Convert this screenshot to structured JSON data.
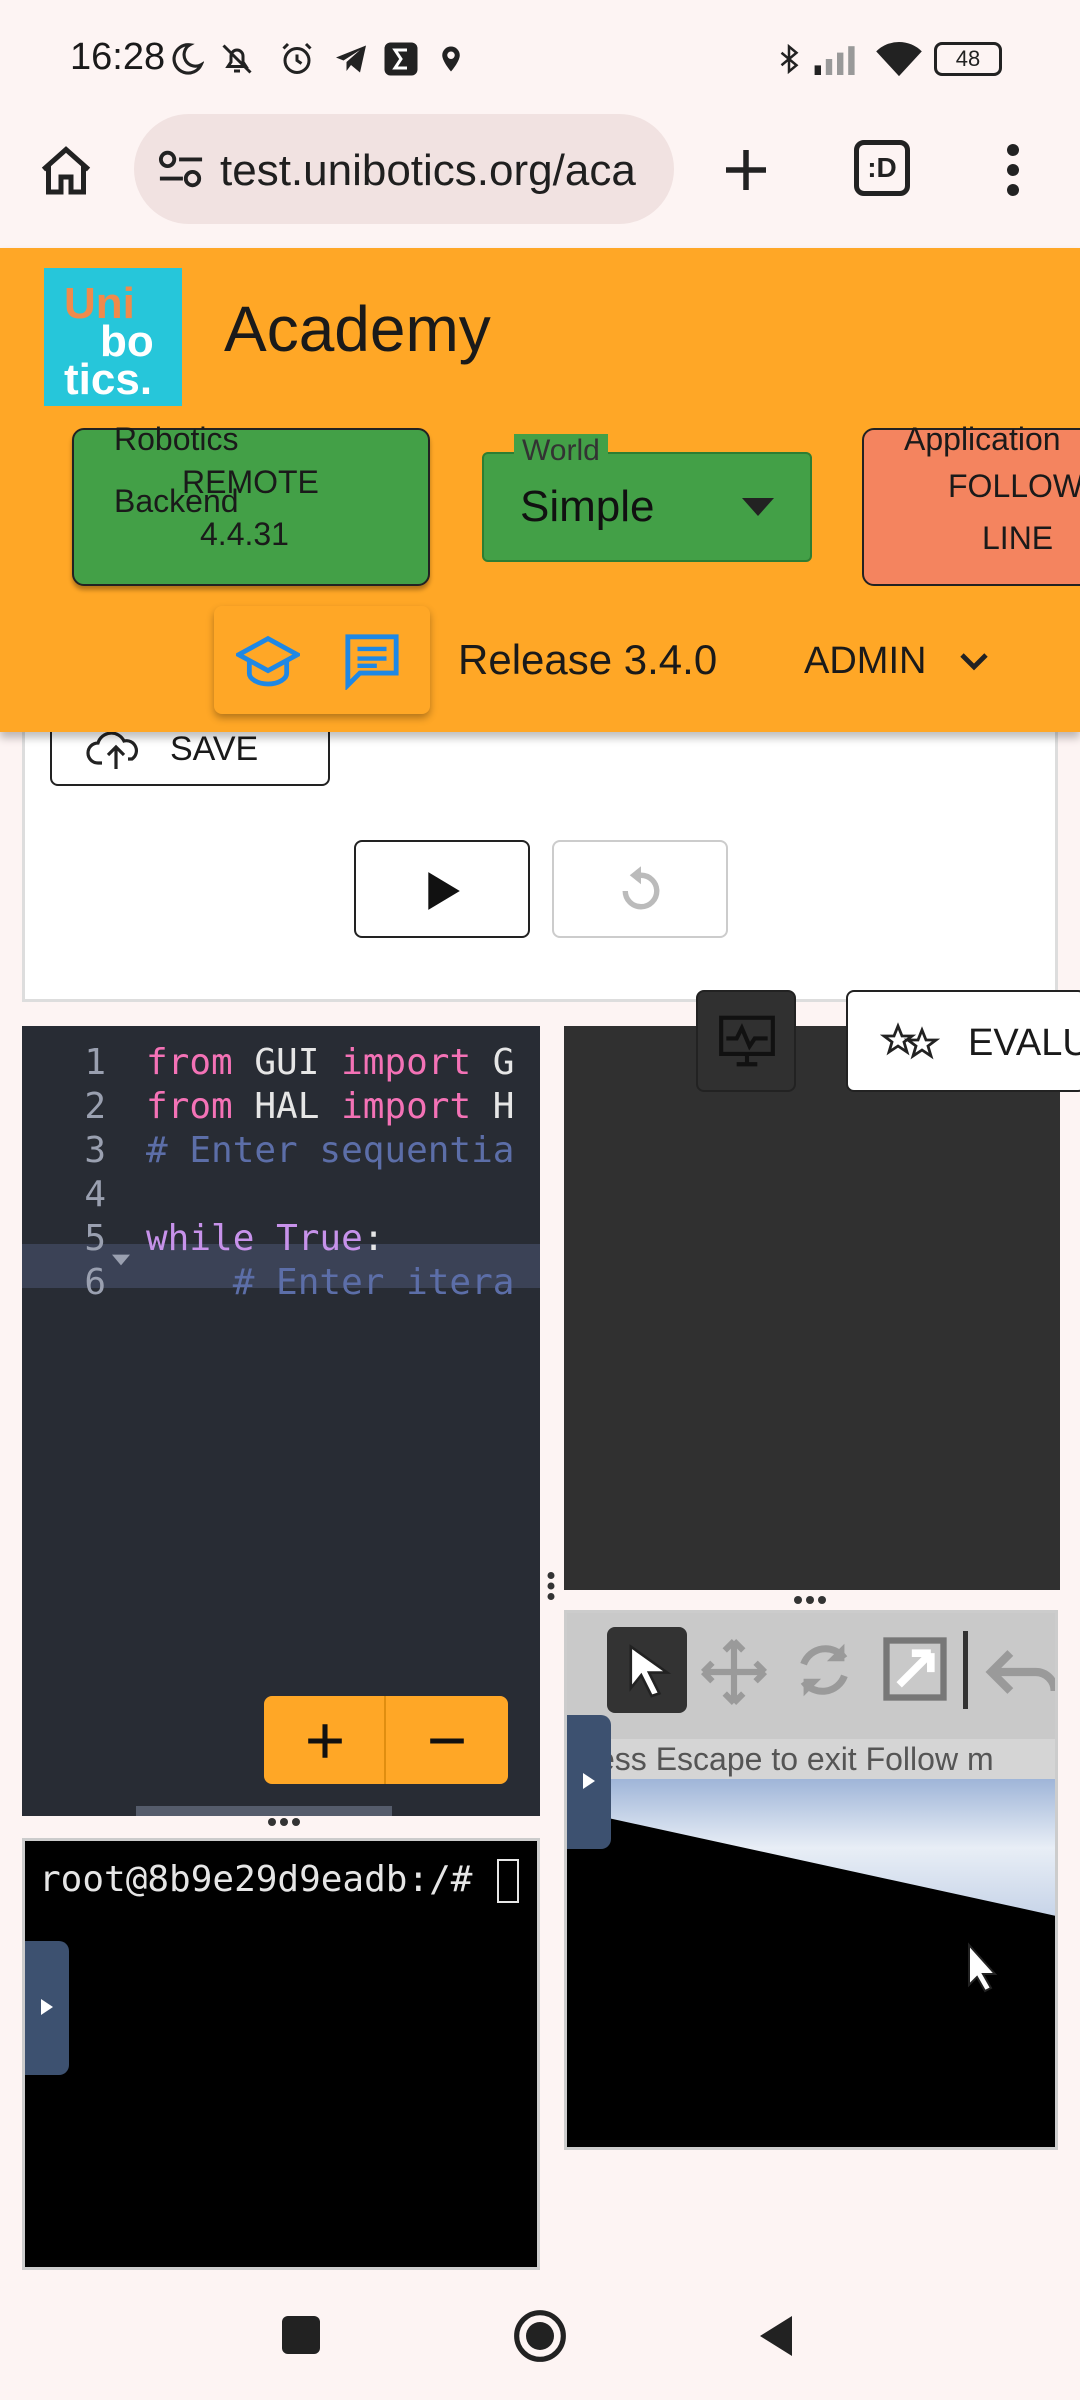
{
  "status_bar": {
    "time": "16:28",
    "battery": "48",
    "icons": [
      "moon-icon",
      "mute-icon",
      "alarm-icon",
      "telegram-icon",
      "sigma-icon",
      "location-icon",
      "bluetooth-icon",
      "signal-icon",
      "wifi-icon",
      "battery-icon"
    ]
  },
  "browser": {
    "url": "test.unibotics.org/aca",
    "tab_label": ":D"
  },
  "header": {
    "logo_lines": [
      "Uni",
      "bo",
      "tics."
    ],
    "title": "Academy",
    "robotics_backend": {
      "label": "Robotics Backend",
      "value_line1": "REMOTE",
      "value_line2": "4.4.31"
    },
    "world": {
      "label": "World",
      "value": "Simple"
    },
    "application": {
      "label": "Application",
      "value_line1": "FOLLOW",
      "value_line2": "LINE"
    },
    "release": "Release 3.4.0",
    "user": "ADMIN"
  },
  "toolbar": {
    "save_label": "SAVE",
    "evaluate_label": "EVALU"
  },
  "editor": {
    "lines": [
      {
        "n": "1",
        "parts": [
          [
            "kw",
            "from"
          ],
          [
            "txt",
            " GUI "
          ],
          [
            "kw",
            "import"
          ],
          [
            "txt",
            " G"
          ]
        ]
      },
      {
        "n": "2",
        "parts": [
          [
            "kw",
            "from"
          ],
          [
            "txt",
            " HAL "
          ],
          [
            "kw",
            "import"
          ],
          [
            "txt",
            " H"
          ]
        ]
      },
      {
        "n": "3",
        "parts": [
          [
            "cm",
            "# Enter sequentia"
          ]
        ]
      },
      {
        "n": "4",
        "parts": []
      },
      {
        "n": "5",
        "parts": [
          [
            "kw2",
            "while"
          ],
          [
            "txt",
            " "
          ],
          [
            "kw2",
            "True"
          ],
          [
            "txt",
            ":"
          ]
        ]
      },
      {
        "n": "6",
        "parts": [
          [
            "cm",
            "    # Enter itera"
          ]
        ]
      }
    ]
  },
  "terminal": {
    "prompt": "root@8b9e29d9eadb:/# "
  },
  "viewer": {
    "hint": "ess Escape to exit Follow m"
  },
  "colors": {
    "header": "#ffa726",
    "green": "#43a047",
    "orange_button": "#f4845f",
    "editor_bg": "#282c34"
  }
}
